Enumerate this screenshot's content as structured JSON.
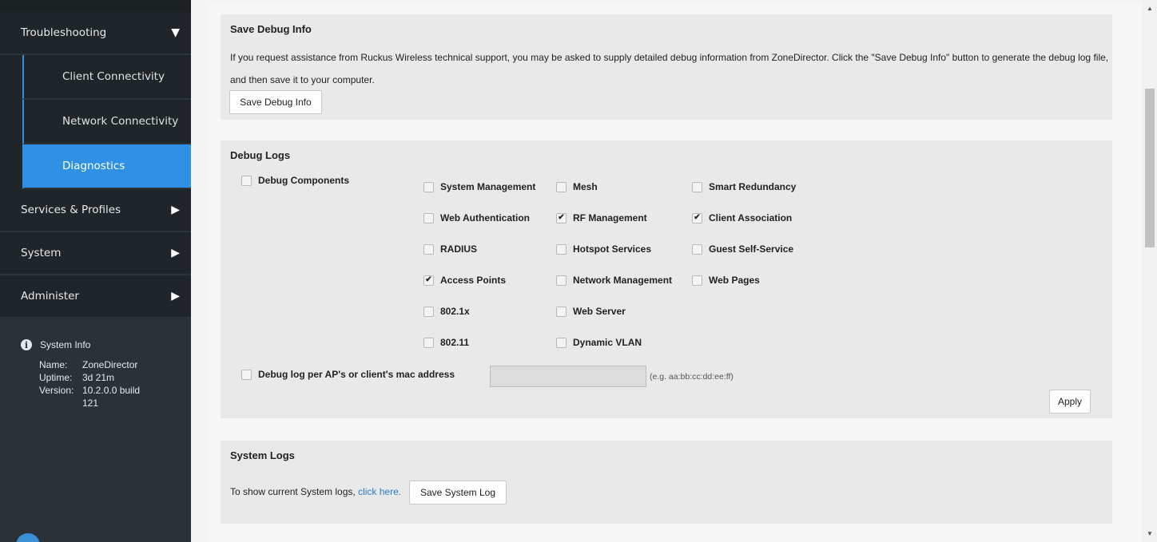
{
  "sidebar": {
    "troubleshooting": "Troubleshooting",
    "sub": [
      "Client Connectivity",
      "Network Connectivity",
      "Diagnostics"
    ],
    "services": "Services & Profiles",
    "system": "System",
    "administer": "Administer",
    "sysinfo": {
      "title": "System Info",
      "name_label": "Name:",
      "name_value": "ZoneDirector",
      "uptime_label": "Uptime:",
      "uptime_value": "3d 21m",
      "version_label": "Version:",
      "version_value": "10.2.0.0 build 121"
    }
  },
  "save_debug": {
    "title": "Save Debug Info",
    "description": "If you request assistance from Ruckus Wireless technical support, you may be asked to supply detailed debug information from ZoneDirector. Click the \"Save Debug Info\" button to generate the debug log file, and then save it to your computer.",
    "button": "Save Debug Info"
  },
  "debug_logs": {
    "title": "Debug Logs",
    "components_label": "Debug Components",
    "options": [
      {
        "label": "System Management",
        "checked": false
      },
      {
        "label": "Mesh",
        "checked": false
      },
      {
        "label": "Smart Redundancy",
        "checked": false
      },
      {
        "label": "Web Authentication",
        "checked": false
      },
      {
        "label": "RF Management",
        "checked": true
      },
      {
        "label": "Client Association",
        "checked": true
      },
      {
        "label": "RADIUS",
        "checked": false
      },
      {
        "label": "Hotspot Services",
        "checked": false
      },
      {
        "label": "Guest Self-Service",
        "checked": false
      },
      {
        "label": "Access Points",
        "checked": true
      },
      {
        "label": "Network Management",
        "checked": false
      },
      {
        "label": "Web Pages",
        "checked": false
      },
      {
        "label": "802.1x",
        "checked": false
      },
      {
        "label": "Web Server",
        "checked": false
      },
      {
        "label": "802.11",
        "checked": false
      },
      {
        "label": "Dynamic VLAN",
        "checked": false
      }
    ],
    "mac_label": "Debug log per AP's or client's mac address",
    "mac_value": "",
    "mac_hint": "(e.g. aa:bb:cc:dd:ee:ff)",
    "apply": "Apply"
  },
  "system_logs": {
    "title": "System Logs",
    "text": "To show current System logs, ",
    "link": "click here.",
    "button": "Save System Log"
  },
  "icons": {
    "expanded": "caret-down-icon",
    "collapsed": "caret-right-icon",
    "info": "info-icon",
    "check": "checkmark-icon"
  }
}
